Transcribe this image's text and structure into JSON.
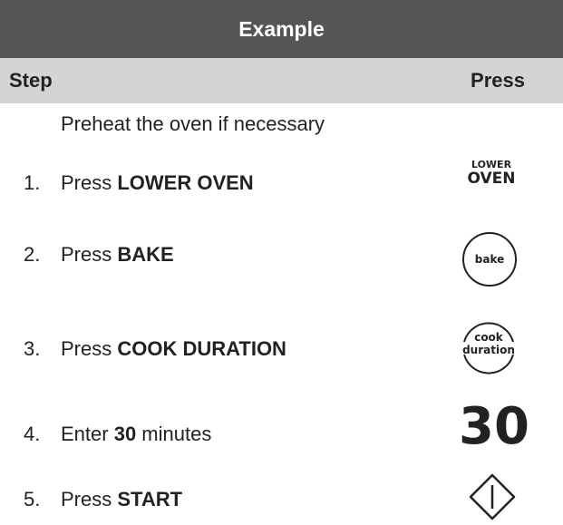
{
  "header": {
    "title": "Example"
  },
  "columns": {
    "step": "Step",
    "press": "Press"
  },
  "intro": "Preheat the oven if necessary",
  "steps": [
    {
      "num": "1.",
      "pre": "Press ",
      "bold": "LOWER OVEN",
      "post": ""
    },
    {
      "num": "2.",
      "pre": "Press ",
      "bold": "BAKE",
      "post": ""
    },
    {
      "num": "3.",
      "pre": "Press ",
      "bold": "COOK DURATION",
      "post": ""
    },
    {
      "num": "4.",
      "pre": "Enter ",
      "bold": "30",
      "post": " minutes"
    },
    {
      "num": "5.",
      "pre": "Press ",
      "bold": "START",
      "post": ""
    }
  ],
  "icons": {
    "lower_oven_line1": "LOWER",
    "lower_oven_line2": "OVEN",
    "bake_label": "bake",
    "cook_line1": "cook",
    "cook_line2": "duration",
    "display_value": "30",
    "lower_oven_icon": "lower-oven-button-icon",
    "bake_icon": "bake-button-icon",
    "cook_icon": "cook-duration-button-icon",
    "start_icon": "start-button-icon"
  },
  "colors": {
    "title_bar": "#555555",
    "header_row": "#d4d4d4",
    "text": "#222222"
  }
}
